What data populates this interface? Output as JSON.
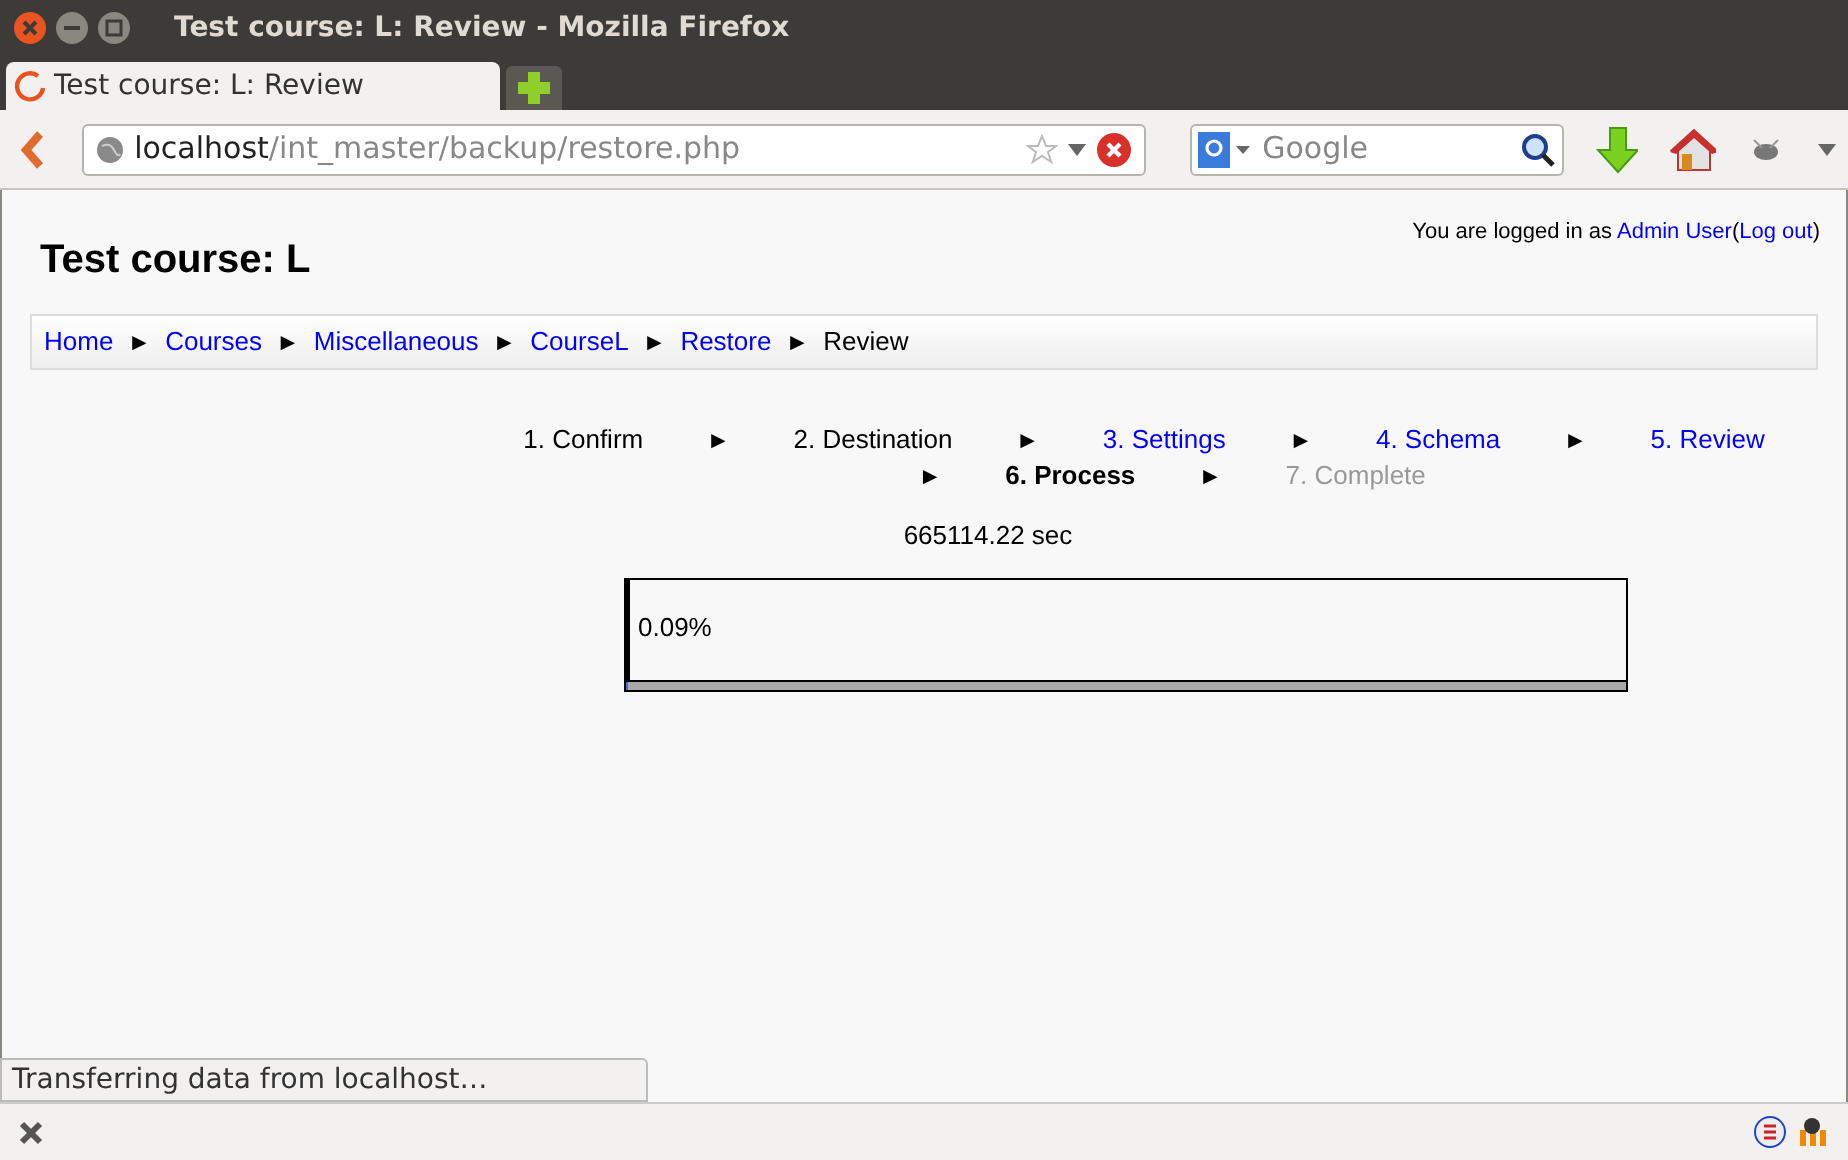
{
  "window": {
    "title": "Test course: L: Review - Mozilla Firefox"
  },
  "tabs": [
    {
      "label": "Test course: L: Review",
      "selected": true
    }
  ],
  "address_bar": {
    "host": "localhost",
    "path": "/int_master/backup/restore.php"
  },
  "search": {
    "engine_placeholder": "Google"
  },
  "page": {
    "heading": "Test course: L",
    "login": {
      "prefix": "You are logged in as ",
      "user": "Admin User",
      "open": "(",
      "logout": "Log out",
      "close": ")"
    },
    "breadcrumb": [
      {
        "label": "Home",
        "kind": "link",
        "arrow": "►"
      },
      {
        "label": "Courses",
        "kind": "link",
        "arrow": "►"
      },
      {
        "label": "Miscellaneous",
        "kind": "link",
        "arrow": "►"
      },
      {
        "label": "CourseL",
        "kind": "link",
        "arrow": "►"
      },
      {
        "label": "Restore",
        "kind": "link",
        "arrow": "►"
      },
      {
        "label": "Review",
        "kind": "text"
      }
    ],
    "steps": [
      {
        "label": "1. Confirm",
        "kind": "done",
        "arrow": "►"
      },
      {
        "label": "2. Destination",
        "kind": "done",
        "arrow": "►"
      },
      {
        "label": "3. Settings",
        "kind": "link",
        "arrow": "►"
      },
      {
        "label": "4. Schema",
        "kind": "link",
        "arrow": "►"
      },
      {
        "label": "5. Review",
        "kind": "link",
        "arrow": "►"
      },
      {
        "label": "6. Process",
        "kind": "current",
        "arrow": "►"
      },
      {
        "label": "7. Complete",
        "kind": "future"
      }
    ],
    "elapsed": "665114.22 sec",
    "progress": {
      "label": "0.09%",
      "level": 0.0009
    }
  },
  "status_popup": "Transferring data from localhost…"
}
